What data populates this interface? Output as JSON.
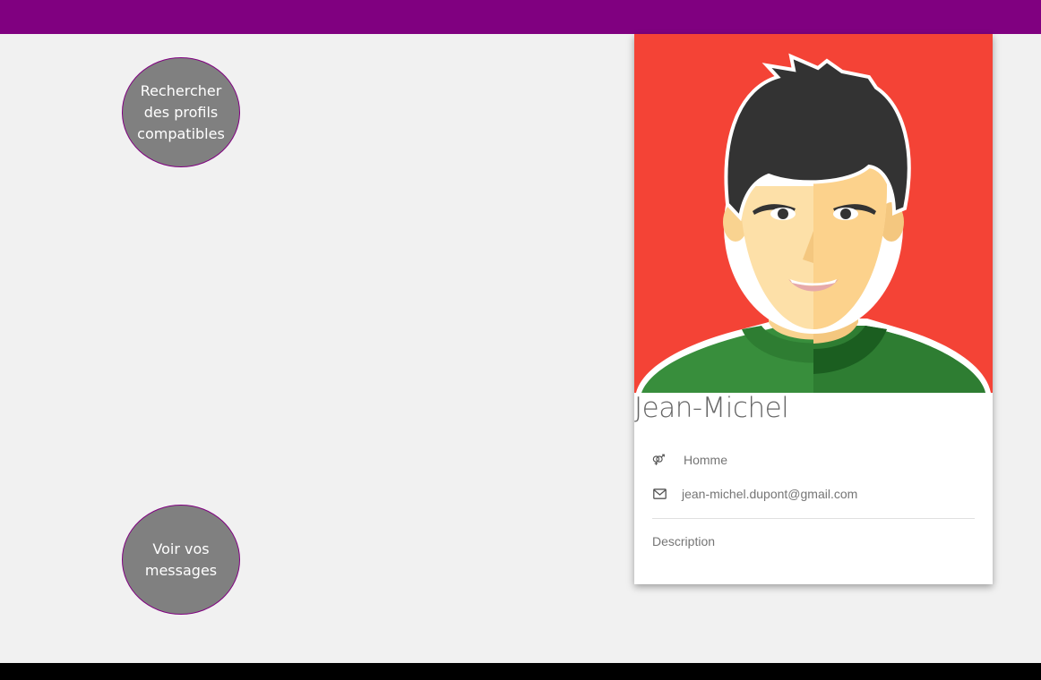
{
  "colors": {
    "header": "#800080",
    "footer": "#000000",
    "background": "#f1f1f1",
    "button_fill": "#808080",
    "button_border": "#800080",
    "avatar_bg": "#f44336"
  },
  "actions": {
    "search_profiles": "Rechercher des profils compatibles",
    "view_messages": "Voir vos messages"
  },
  "profile": {
    "name": "Jean-Michel",
    "gender": "Homme",
    "gender_icon": "gender-icon",
    "email": "jean-michel.dupont@gmail.com",
    "email_icon": "envelope-icon",
    "description_label": "Description"
  }
}
